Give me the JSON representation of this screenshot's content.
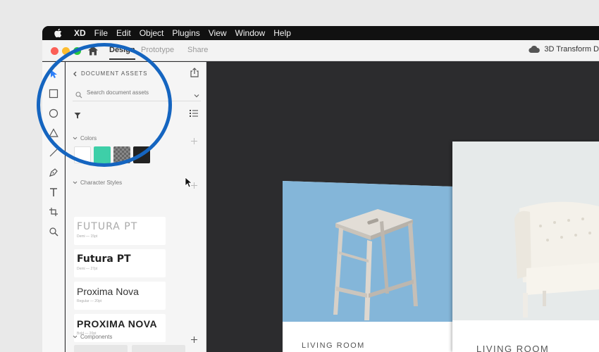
{
  "menubar": {
    "items": [
      "XD",
      "File",
      "Edit",
      "Object",
      "Plugins",
      "View",
      "Window",
      "Help"
    ]
  },
  "titlebar": {
    "tabs": [
      "Design",
      "Prototype",
      "Share"
    ],
    "document_title": "3D Transform D"
  },
  "assets_panel": {
    "header": "DOCUMENT ASSETS",
    "search_placeholder": "Search document assets",
    "sections": {
      "colors": "Colors",
      "character_styles": "Character Styles",
      "components": "Components"
    },
    "colors": [
      "#ffffff",
      "#3ecfa8",
      "checker",
      "#222222"
    ],
    "character_styles": [
      {
        "name": "FUTURA PT",
        "meta": "Demi — 15pt"
      },
      {
        "name": "Futura PT",
        "meta": "Demi — 27pt"
      },
      {
        "name": "Proxima Nova",
        "meta": "Regular — 20pt"
      },
      {
        "name": "PROXIMA NOVA",
        "meta": "Bold — 20pt"
      }
    ]
  },
  "canvas": {
    "cards": [
      {
        "label": "LIVING ROOM"
      },
      {
        "label": "LIVING ROOM"
      }
    ]
  },
  "colors": {
    "accent_circle": "#1565c0",
    "canvas_bg": "#2c2c2e",
    "teal_swatch": "#3ecfa8",
    "dark_swatch": "#222222"
  }
}
